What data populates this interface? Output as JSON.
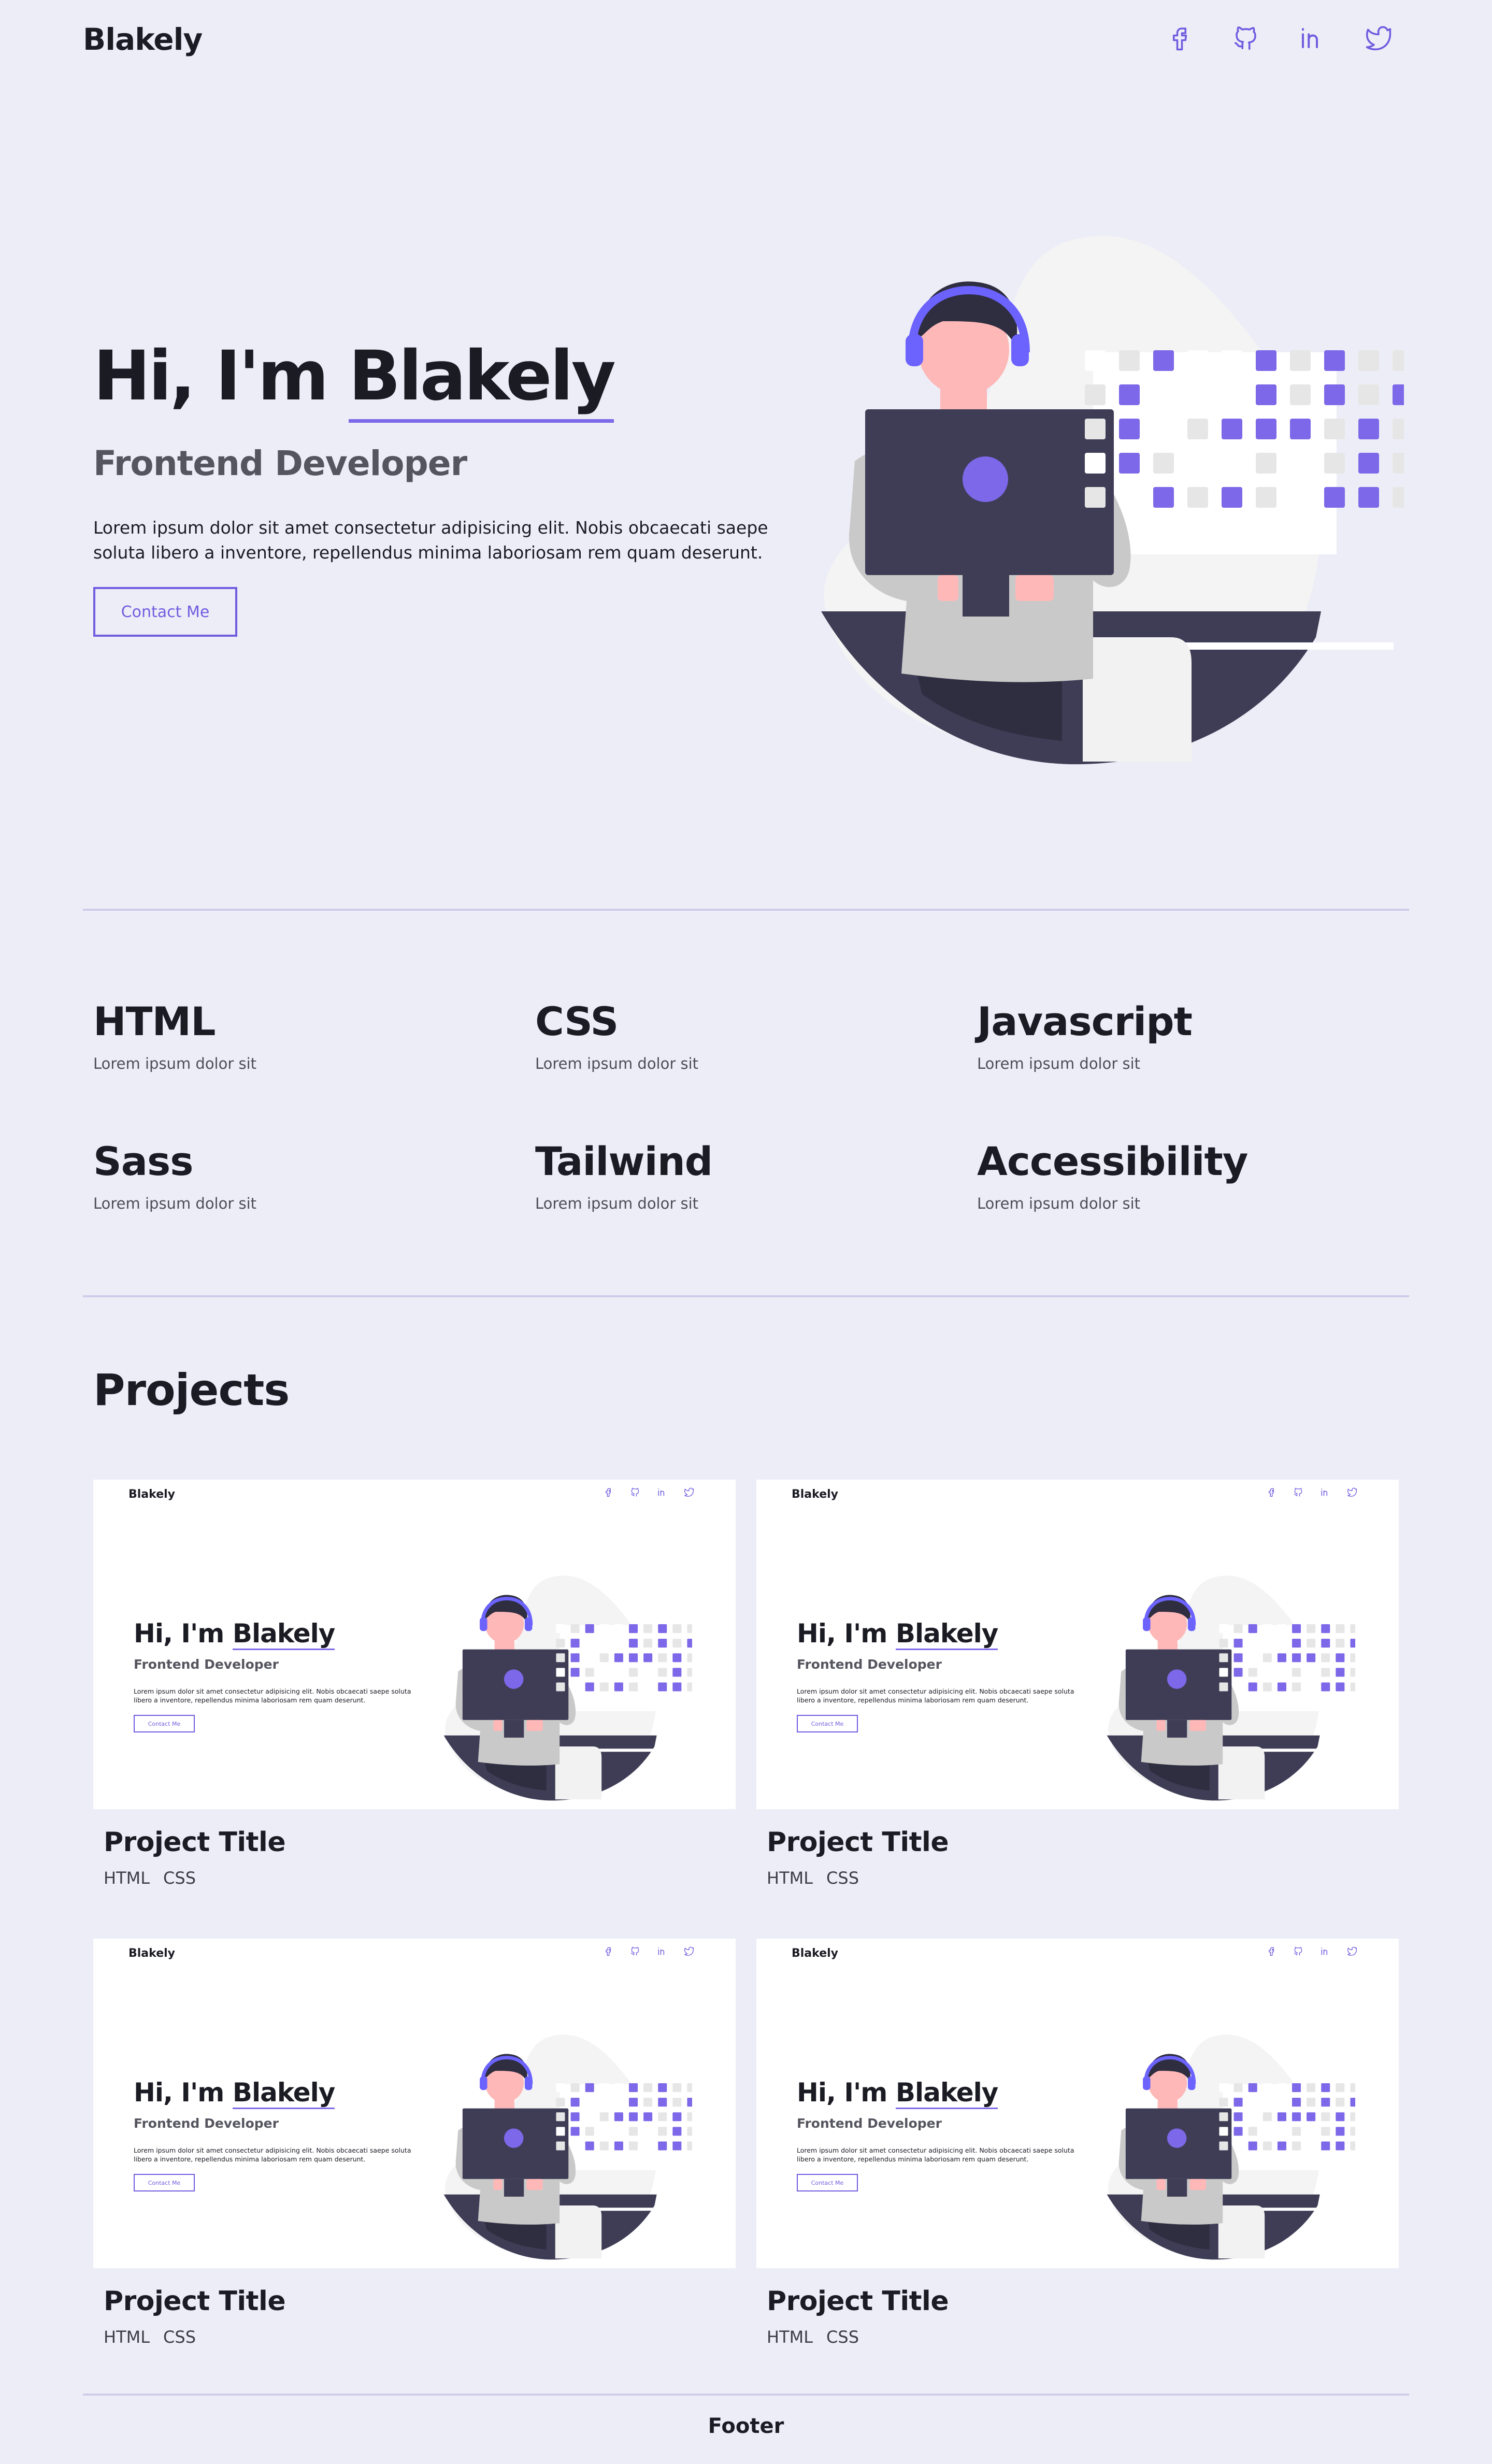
{
  "header": {
    "brand": "Blakely",
    "social_icons": [
      "facebook-icon",
      "github-icon",
      "linkedin-icon",
      "twitter-icon"
    ]
  },
  "hero": {
    "greeting": "Hi, I'm",
    "name": "Blakely",
    "role": "Frontend Developer",
    "description": "Lorem ipsum dolor sit amet consectetur adipisicing elit. Nobis obcaecati saepe soluta libero a inventore, repellendus minima laboriosam rem quam deserunt.",
    "cta_label": "Contact Me"
  },
  "skills": [
    {
      "title": "HTML",
      "text": "Lorem ipsum dolor sit"
    },
    {
      "title": "CSS",
      "text": "Lorem ipsum dolor sit"
    },
    {
      "title": "Javascript",
      "text": "Lorem ipsum dolor sit"
    },
    {
      "title": "Sass",
      "text": "Lorem ipsum dolor sit"
    },
    {
      "title": "Tailwind",
      "text": "Lorem ipsum dolor sit"
    },
    {
      "title": "Accessibility",
      "text": "Lorem ipsum dolor sit"
    }
  ],
  "projects": {
    "title": "Projects",
    "items": [
      {
        "title": "Project Title",
        "tags": [
          "HTML",
          "CSS"
        ]
      },
      {
        "title": "Project Title",
        "tags": [
          "HTML",
          "CSS"
        ]
      },
      {
        "title": "Project Title",
        "tags": [
          "HTML",
          "CSS"
        ]
      },
      {
        "title": "Project Title",
        "tags": [
          "HTML",
          "CSS"
        ]
      }
    ]
  },
  "footer": {
    "label": "Footer"
  },
  "colors": {
    "accent": "#6F5DE0",
    "background": "#EDEDF7",
    "text": "#1B1B24",
    "muted": "#55555F"
  }
}
